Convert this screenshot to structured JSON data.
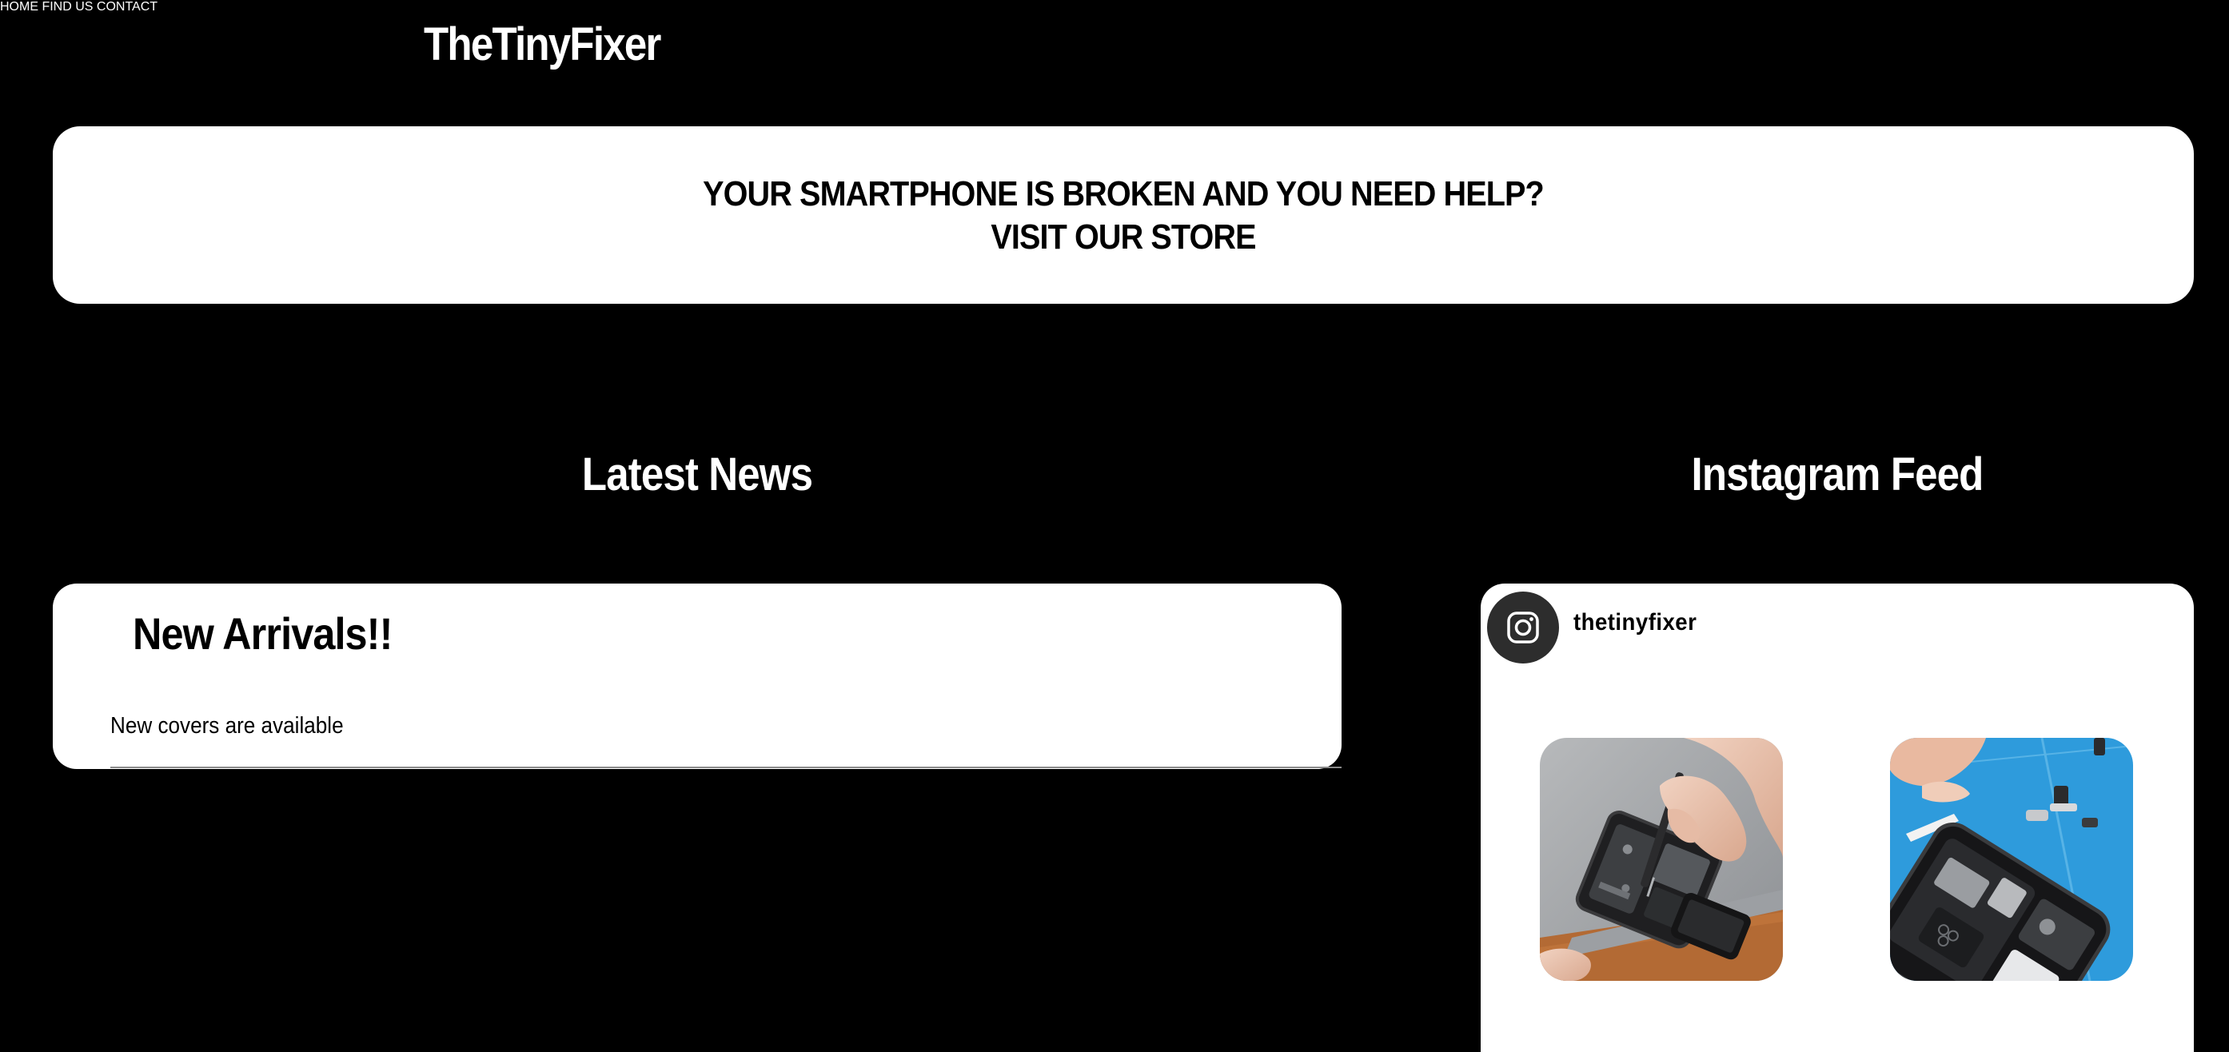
{
  "header": {
    "logo": "TheTinyFixer",
    "nav": [
      {
        "label": "HOME"
      },
      {
        "label": "FIND US"
      },
      {
        "label": "CONTACT"
      }
    ]
  },
  "hero": {
    "line1": "YOUR SMARTPHONE IS BROKEN AND YOU NEED HELP?",
    "line2": "VISIT OUR STORE"
  },
  "news": {
    "section_title": "Latest News",
    "items": [
      {
        "title": "New Arrivals!!",
        "body": "New covers are available"
      }
    ]
  },
  "instagram": {
    "section_title": "Instagram Feed",
    "handle": "thetinyfixer",
    "avatar_icon": "instagram-icon",
    "posts": [
      {
        "subject": "hand unscrewing an opened phone with a screwdriver on a grey mat"
      },
      {
        "subject": "opened phone internals on a blue repair mat"
      }
    ]
  },
  "colors": {
    "background": "#000000",
    "card": "#ffffff",
    "text_dark": "#000000",
    "text_light": "#ffffff",
    "avatar_bg": "#2d2d2d",
    "repair_mat_blue": "#2e9bdc"
  }
}
